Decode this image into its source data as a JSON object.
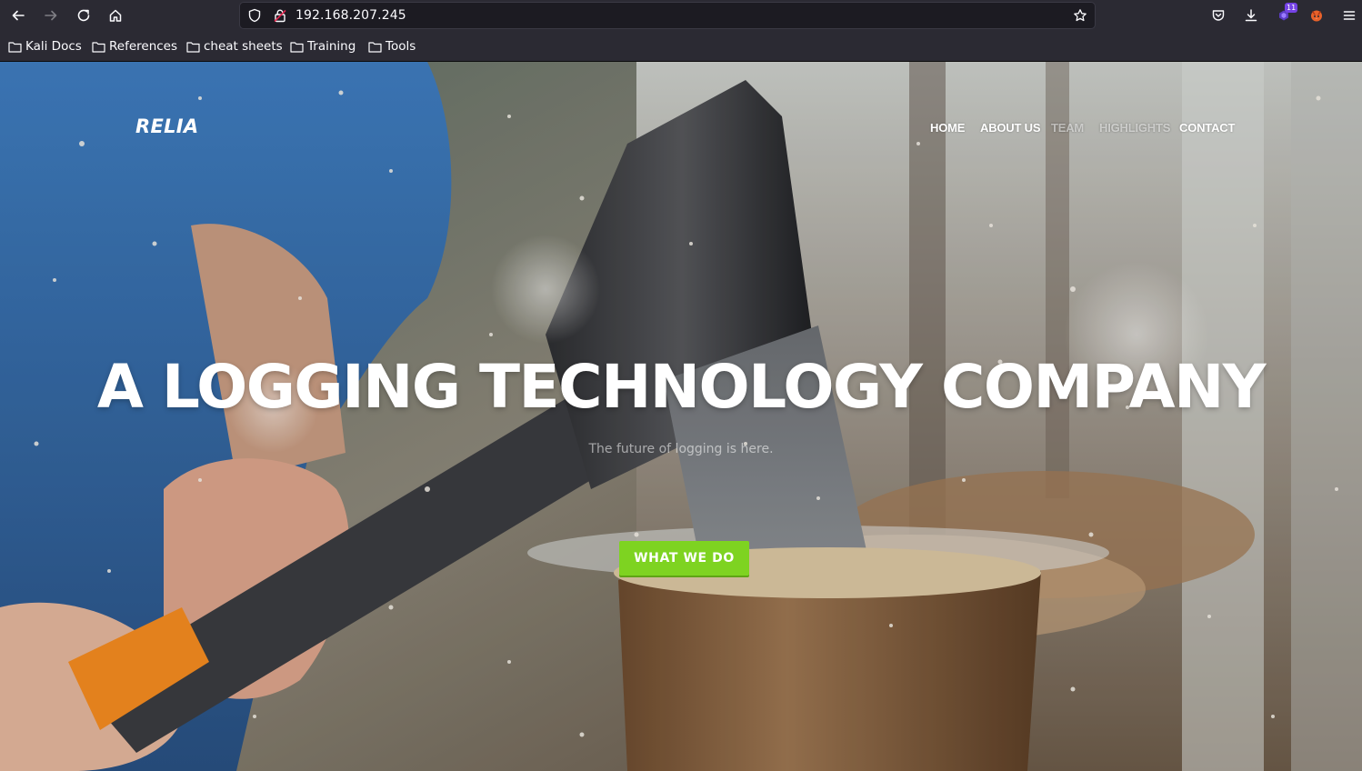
{
  "browser": {
    "url": "192.168.207.245",
    "notification_count": "11",
    "bookmarks": [
      {
        "label": "Kali Docs"
      },
      {
        "label": "References"
      },
      {
        "label": "cheat sheets"
      },
      {
        "label": "Training"
      },
      {
        "label": "Tools"
      }
    ]
  },
  "site": {
    "brand": "RELIA",
    "nav": [
      {
        "label": "HOME"
      },
      {
        "label": "ABOUT US"
      },
      {
        "label": "TEAM"
      },
      {
        "label": "HIGHLIGHTS"
      },
      {
        "label": "CONTACT"
      }
    ],
    "hero": {
      "title": "A LOGGING TECHNOLOGY COMPANY",
      "subtitle": "The future of logging is here.",
      "cta_label": "WHAT WE DO"
    }
  },
  "colors": {
    "chrome_bg": "#2b2a33",
    "urlbar_bg": "#1c1b22",
    "cta_green": "#7ed321",
    "text_light": "#fbfbfe"
  }
}
